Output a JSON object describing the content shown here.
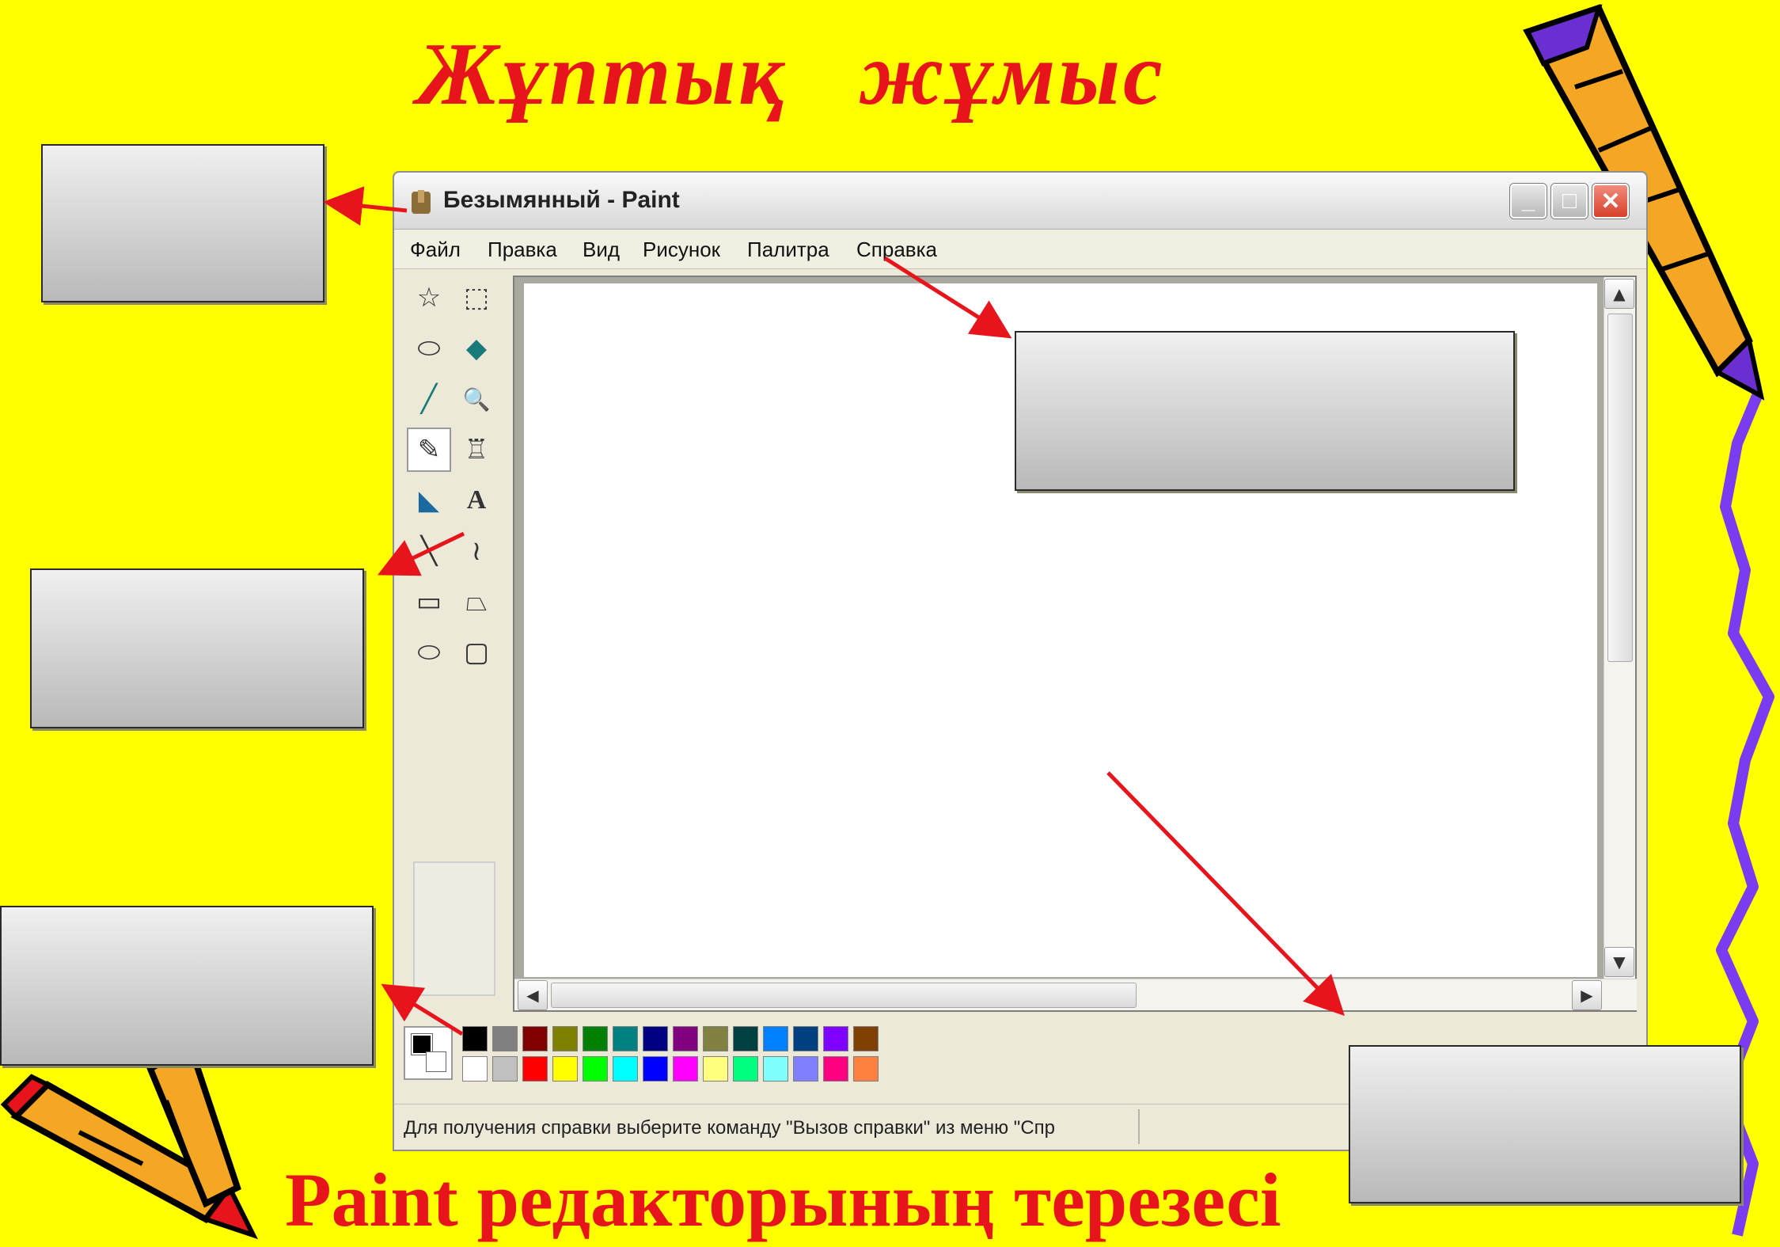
{
  "slide": {
    "title": "Жұптық жұмыс",
    "subtitle": "Paint редакторының терезесі"
  },
  "window": {
    "title": "Безымянный - Paint",
    "controls": {
      "minimize": "_",
      "maximize": "□",
      "close": "✕"
    },
    "menu": [
      "Файл",
      "Правка",
      "Вид",
      "Рисунок",
      "Палитра",
      "Справка"
    ],
    "status": "Для получения справки выберите команду \"Вызов справки\" из меню \"Спр",
    "scroll_icons": {
      "up": "▲",
      "down": "▼",
      "left": "◀",
      "right": "▶"
    }
  },
  "tools": [
    {
      "name": "free-select-icon",
      "glyph": "☆"
    },
    {
      "name": "rect-select-icon",
      "glyph": "⬚"
    },
    {
      "name": "eraser-icon",
      "glyph": "⬭"
    },
    {
      "name": "fill-icon",
      "glyph": "◆"
    },
    {
      "name": "color-picker-icon",
      "glyph": "╱"
    },
    {
      "name": "magnifier-icon",
      "glyph": "🔍"
    },
    {
      "name": "pencil-icon",
      "glyph": "✎"
    },
    {
      "name": "brush-icon",
      "glyph": "♖"
    },
    {
      "name": "airbrush-icon",
      "glyph": "◣"
    },
    {
      "name": "text-icon",
      "glyph": "A"
    },
    {
      "name": "line-icon",
      "glyph": "╲"
    },
    {
      "name": "curve-icon",
      "glyph": "≀"
    },
    {
      "name": "rectangle-icon",
      "glyph": "▭"
    },
    {
      "name": "polygon-icon",
      "glyph": "⏢"
    },
    {
      "name": "ellipse-icon",
      "glyph": "⬭"
    },
    {
      "name": "rounded-rect-icon",
      "glyph": "▢"
    }
  ],
  "palette": {
    "top": [
      "#000000",
      "#808080",
      "#800000",
      "#808000",
      "#008000",
      "#008080",
      "#000080",
      "#800080",
      "#808040",
      "#004040",
      "#0080ff",
      "#004080",
      "#8000ff",
      "#804000"
    ],
    "bottom": [
      "#ffffff",
      "#c0c0c0",
      "#ff0000",
      "#ffff00",
      "#00ff00",
      "#00ffff",
      "#0000ff",
      "#ff00ff",
      "#ffff80",
      "#00ff80",
      "#80ffff",
      "#8080ff",
      "#ff0080",
      "#ff8040"
    ]
  },
  "colors": {
    "background": "#ffff00",
    "accent_red": "#e8141b",
    "arrow": "#e8141b"
  }
}
